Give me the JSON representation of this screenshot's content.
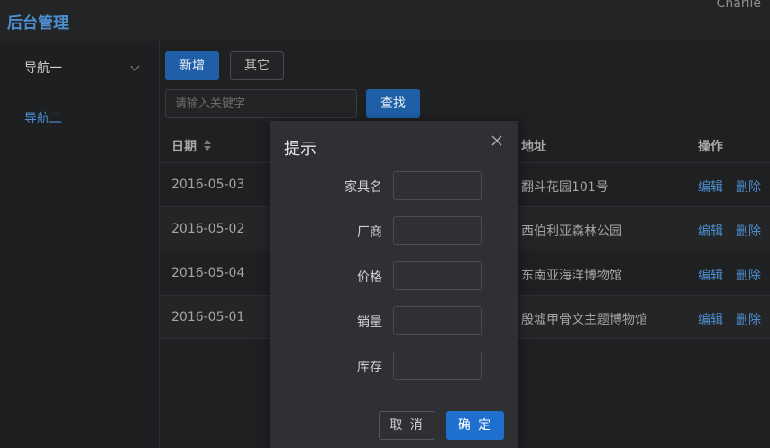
{
  "header": {
    "title": "后台管理",
    "user": "Charlie"
  },
  "sidebar": {
    "items": [
      {
        "label": "导航一",
        "icon": "chevron-down-icon"
      },
      {
        "label": "导航二"
      }
    ]
  },
  "toolbar": {
    "add_label": "新增",
    "other_label": "其它",
    "search_placeholder": "请输入关键字",
    "search_value": "",
    "find_label": "查找"
  },
  "table": {
    "headers": {
      "date": "日期",
      "address": "地址",
      "actions": "操作"
    },
    "rows": [
      {
        "date": "2016-05-03",
        "address": "翻斗花园101号",
        "edit": "编辑",
        "delete": "删除"
      },
      {
        "date": "2016-05-02",
        "address": "西伯利亚森林公园",
        "edit": "编辑",
        "delete": "删除"
      },
      {
        "date": "2016-05-04",
        "address": "东南亚海洋博物馆",
        "edit": "编辑",
        "delete": "删除"
      },
      {
        "date": "2016-05-01",
        "address": "殷墟甲骨文主题博物馆",
        "edit": "编辑",
        "delete": "删除"
      }
    ]
  },
  "dialog": {
    "title": "提示",
    "fields": [
      {
        "label": "家具名",
        "value": ""
      },
      {
        "label": "厂商",
        "value": ""
      },
      {
        "label": "价格",
        "value": ""
      },
      {
        "label": "销量",
        "value": ""
      },
      {
        "label": "库存",
        "value": ""
      }
    ],
    "cancel_label": "取 消",
    "ok_label": "确 定"
  },
  "colors": {
    "accent": "#4c8ed0",
    "primary_button": "#1e5fa8",
    "ok_button": "#1e6fce",
    "background": "#1f2022"
  }
}
